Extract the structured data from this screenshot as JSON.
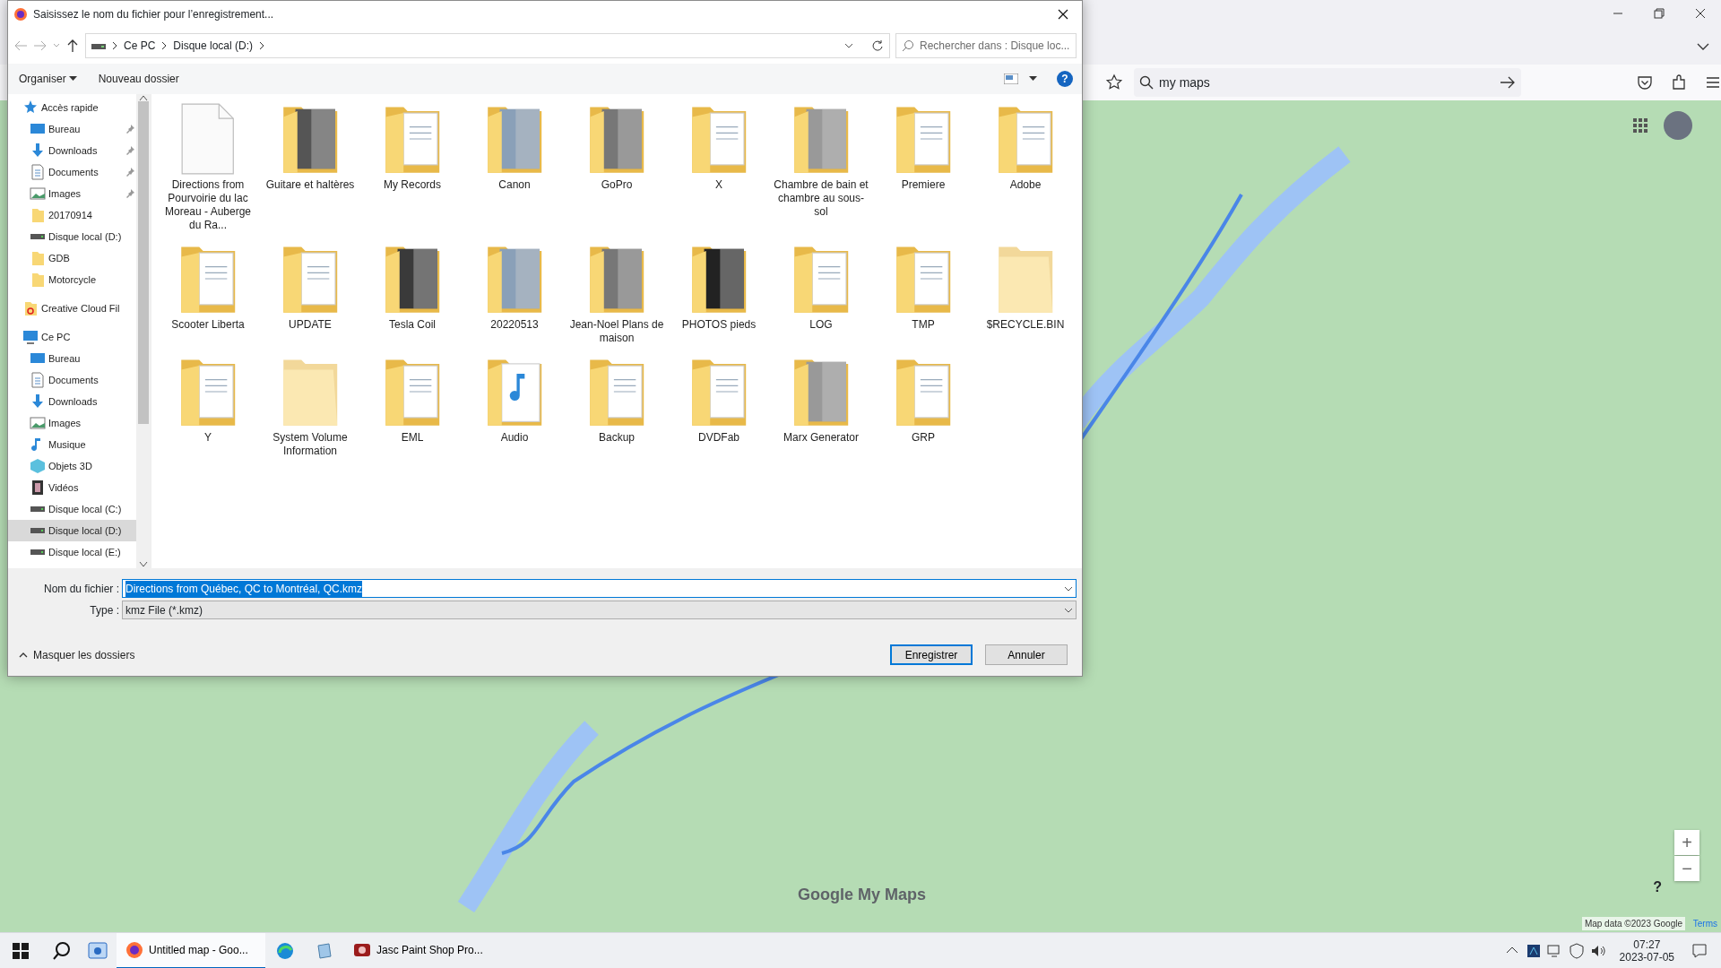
{
  "browser": {
    "url_field": {
      "value": "my maps"
    },
    "map": {
      "logo": "Google My Maps",
      "attribution": "Map data ©2023 Google",
      "terms": "Terms",
      "zoom_in": "+",
      "zoom_out": "−",
      "help": "?"
    }
  },
  "dialog": {
    "title": "Saisissez le nom du fichier pour l’enregistrement...",
    "breadcrumb": [
      "Ce PC",
      "Disque local (D:)"
    ],
    "search": {
      "placeholder": "Rechercher dans : Disque loc..."
    },
    "toolbar": [
      {
        "label": "Organiser",
        "dropdown": true
      },
      {
        "label": "Nouveau dossier",
        "dropdown": false
      }
    ],
    "help": "?",
    "sidebar": [
      {
        "label": "Accès rapide",
        "kind": "star",
        "pinned": false,
        "selected": false,
        "children": [
          {
            "label": "Bureau",
            "kind": "desktop",
            "pinned": true,
            "selected": false
          },
          {
            "label": "Downloads",
            "kind": "download",
            "pinned": true,
            "selected": false
          },
          {
            "label": "Documents",
            "kind": "document",
            "pinned": true,
            "selected": false
          },
          {
            "label": "Images",
            "kind": "picture",
            "pinned": true,
            "selected": false
          },
          {
            "label": "20170914",
            "kind": "folder",
            "pinned": false,
            "selected": false
          },
          {
            "label": "Disque local (D:)",
            "kind": "drive",
            "pinned": false,
            "selected": false
          },
          {
            "label": "GDB",
            "kind": "folder",
            "pinned": false,
            "selected": false
          },
          {
            "label": "Motorcycle",
            "kind": "folder",
            "pinned": false,
            "selected": false
          }
        ]
      },
      {
        "label": "Creative Cloud Fil",
        "kind": "cloud",
        "pinned": false,
        "selected": false
      },
      {
        "label": "Ce PC",
        "kind": "computer",
        "pinned": false,
        "selected": false,
        "children": [
          {
            "label": "Bureau",
            "kind": "desktop",
            "pinned": false,
            "selected": false
          },
          {
            "label": "Documents",
            "kind": "document",
            "pinned": false,
            "selected": false
          },
          {
            "label": "Downloads",
            "kind": "download",
            "pinned": false,
            "selected": false
          },
          {
            "label": "Images",
            "kind": "picture",
            "pinned": false,
            "selected": false
          },
          {
            "label": "Musique",
            "kind": "music",
            "pinned": false,
            "selected": false
          },
          {
            "label": "Objets 3D",
            "kind": "cube",
            "pinned": false,
            "selected": false
          },
          {
            "label": "Vidéos",
            "kind": "film",
            "pinned": false,
            "selected": false
          },
          {
            "label": "Disque local (C:)",
            "kind": "drive",
            "pinned": false,
            "selected": false
          },
          {
            "label": "Disque local (D:)",
            "kind": "drive",
            "pinned": false,
            "selected": true
          },
          {
            "label": "Disque local (E:)",
            "kind": "drive",
            "pinned": false,
            "selected": false
          }
        ]
      }
    ],
    "files": [
      {
        "label": "Directions from Pourvoirie du lac Moreau - Auberge du Ra...",
        "kind": "file"
      },
      {
        "label": "Guitare et haltères",
        "kind": "photo-folder"
      },
      {
        "label": "My Records",
        "kind": "folder"
      },
      {
        "label": "Canon",
        "kind": "photo-folder"
      },
      {
        "label": "GoPro",
        "kind": "photo-folder"
      },
      {
        "label": "X",
        "kind": "folder"
      },
      {
        "label": "Chambre de bain et chambre au sous-sol",
        "kind": "photo-folder"
      },
      {
        "label": "Premiere",
        "kind": "folder"
      },
      {
        "label": "Adobe",
        "kind": "folder"
      },
      {
        "label": "Scooter Liberta",
        "kind": "folder"
      },
      {
        "label": "UPDATE",
        "kind": "folder"
      },
      {
        "label": "Tesla Coil",
        "kind": "photo-folder"
      },
      {
        "label": "20220513",
        "kind": "photo-folder"
      },
      {
        "label": "Jean-Noel Plans de maison",
        "kind": "photo-folder"
      },
      {
        "label": "PHOTOS pieds",
        "kind": "photo-folder"
      },
      {
        "label": "LOG",
        "kind": "folder"
      },
      {
        "label": "TMP",
        "kind": "folder"
      },
      {
        "label": "$RECYCLE.BIN",
        "kind": "hidden-folder"
      },
      {
        "label": "Y",
        "kind": "folder"
      },
      {
        "label": "System Volume Information",
        "kind": "hidden-folder"
      },
      {
        "label": "EML",
        "kind": "folder"
      },
      {
        "label": "Audio",
        "kind": "audio-folder"
      },
      {
        "label": "Backup",
        "kind": "folder"
      },
      {
        "label": "DVDFab",
        "kind": "folder"
      },
      {
        "label": "Marx Generator",
        "kind": "photo-folder"
      },
      {
        "label": "GRP",
        "kind": "folder"
      }
    ],
    "filename": {
      "label": "Nom du fichier :",
      "value": "Directions from Québec, QC to Montréal, QC.kmz",
      "text_selected": true
    },
    "type": {
      "label": "Type :",
      "value": "kmz File (*.kmz)"
    },
    "hide_folders": "Masquer les dossiers",
    "buttons": [
      {
        "label": "Enregistrer",
        "default": true
      },
      {
        "label": "Annuler",
        "default": false
      }
    ]
  },
  "taskbar": {
    "apps": [
      {
        "label": "Untitled map - Goo...",
        "kind": "browser",
        "selected": true
      },
      {
        "label": "Jasc Paint Shop Pro...",
        "kind": "paint",
        "selected": false
      }
    ],
    "time": "07:27",
    "date": "2023-07-05"
  }
}
